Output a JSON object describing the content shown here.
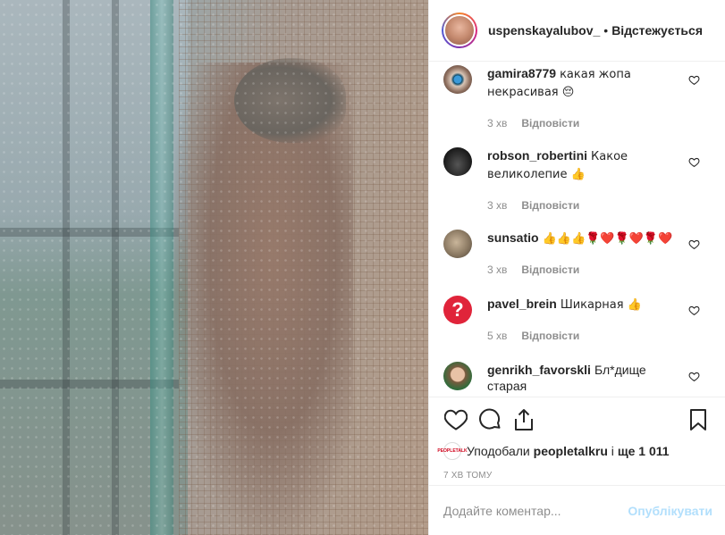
{
  "header": {
    "username": "uspenskayalubov_",
    "separator": "•",
    "follow_label": "Відстежується"
  },
  "comments": [
    {
      "user": "gamira8779",
      "text": "какая жопа некрасивая 😔",
      "time": "3 хв",
      "reply": "Відповісти",
      "avatar_icon": "eye-avatar"
    },
    {
      "user": "robson_robertini",
      "text": "Какое великолепие 👍",
      "time": "3 хв",
      "reply": "Відповісти",
      "avatar_icon": "car-avatar"
    },
    {
      "user": "sunsatio",
      "text": "👍👍👍🌹❤️🌹❤️🌹❤️",
      "time": "3 хв",
      "reply": "Відповісти",
      "avatar_icon": "cat-avatar"
    },
    {
      "user": "pavel_brein",
      "text": "Шикарная 👍",
      "time": "5 хв",
      "reply": "Відповісти",
      "avatar_icon": "question-avatar"
    },
    {
      "user": "genrikh_favorskli",
      "text": "Бл*дище старая",
      "time": "",
      "reply": "",
      "avatar_icon": "boy-avatar"
    }
  ],
  "actions": {
    "icons": [
      "heart-icon",
      "comment-icon",
      "share-icon",
      "bookmark-icon"
    ]
  },
  "likes": {
    "prefix": "Уподобали",
    "user": "peopletalkru",
    "middle": "і",
    "count": "ще 1 011",
    "avatar_text": "PEOPLETALK"
  },
  "time_ago": "7 хв тому",
  "add_comment": {
    "placeholder": "Додайте коментар...",
    "publish": "Опублікувати"
  },
  "colors": {
    "text": "#262626",
    "secondary": "#8e8e8e",
    "publish_disabled": "#b2dffc",
    "border": "#efefef"
  }
}
